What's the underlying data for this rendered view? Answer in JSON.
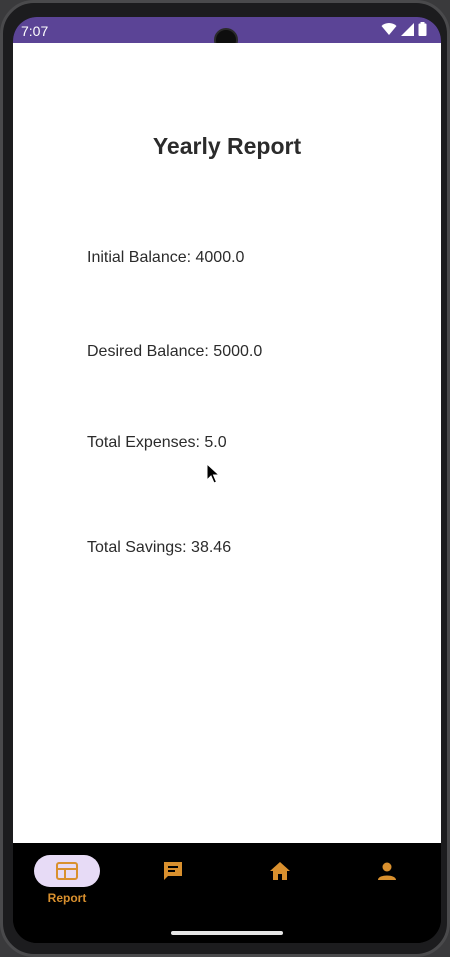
{
  "status_bar": {
    "time": "7:07"
  },
  "page": {
    "title": "Yearly Report"
  },
  "stats": {
    "initial_balance": "Initial Balance: 4000.0",
    "desired_balance": "Desired Balance: 5000.0",
    "total_expenses": "Total Expenses: 5.0",
    "total_savings": "Total Savings: 38.46"
  },
  "bottom_nav": {
    "items": [
      {
        "label": "Report",
        "icon": "report-icon",
        "active": true
      },
      {
        "label": "",
        "icon": "chat-icon",
        "active": false
      },
      {
        "label": "",
        "icon": "home-icon",
        "active": false
      },
      {
        "label": "",
        "icon": "person-icon",
        "active": false
      }
    ]
  },
  "colors": {
    "status_bar": "#5b4496",
    "nav_icon": "#d9902e",
    "active_pill": "#e7dbf6"
  }
}
